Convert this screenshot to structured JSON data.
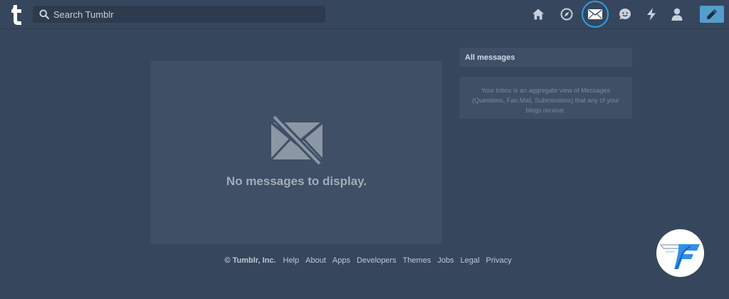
{
  "header": {
    "logo_icon": "tumblr-logo-icon",
    "search": {
      "placeholder": "Search Tumblr",
      "value": "",
      "icon": "search-icon"
    },
    "nav": [
      {
        "name": "home",
        "icon": "home-icon"
      },
      {
        "name": "explore",
        "icon": "compass-icon"
      },
      {
        "name": "inbox",
        "icon": "envelope-icon",
        "active": true
      },
      {
        "name": "messaging",
        "icon": "chat-bubble-icon"
      },
      {
        "name": "activity",
        "icon": "lightning-icon"
      },
      {
        "name": "account",
        "icon": "user-icon"
      }
    ],
    "compose_icon": "pencil-icon",
    "accent_color": "#2aa1e8",
    "compose_color": "#529ecc"
  },
  "main": {
    "empty_icon": "envelope-crossed-icon",
    "empty_message": "No messages to display."
  },
  "sidebar": {
    "header": "All messages",
    "info": "Your Inbox is an aggregate view of Messages (Questions, Fan Mail, Submissions) that any of your blogs receive."
  },
  "footer": {
    "copyright": "© Tumblr, Inc.",
    "links": [
      "Help",
      "About",
      "Apps",
      "Developers",
      "Themes",
      "Jobs",
      "Legal",
      "Privacy"
    ]
  },
  "watermark": {
    "icon": "watermark-logo-icon"
  },
  "colors": {
    "background": "#36465d",
    "panel": "#3e4f66"
  }
}
